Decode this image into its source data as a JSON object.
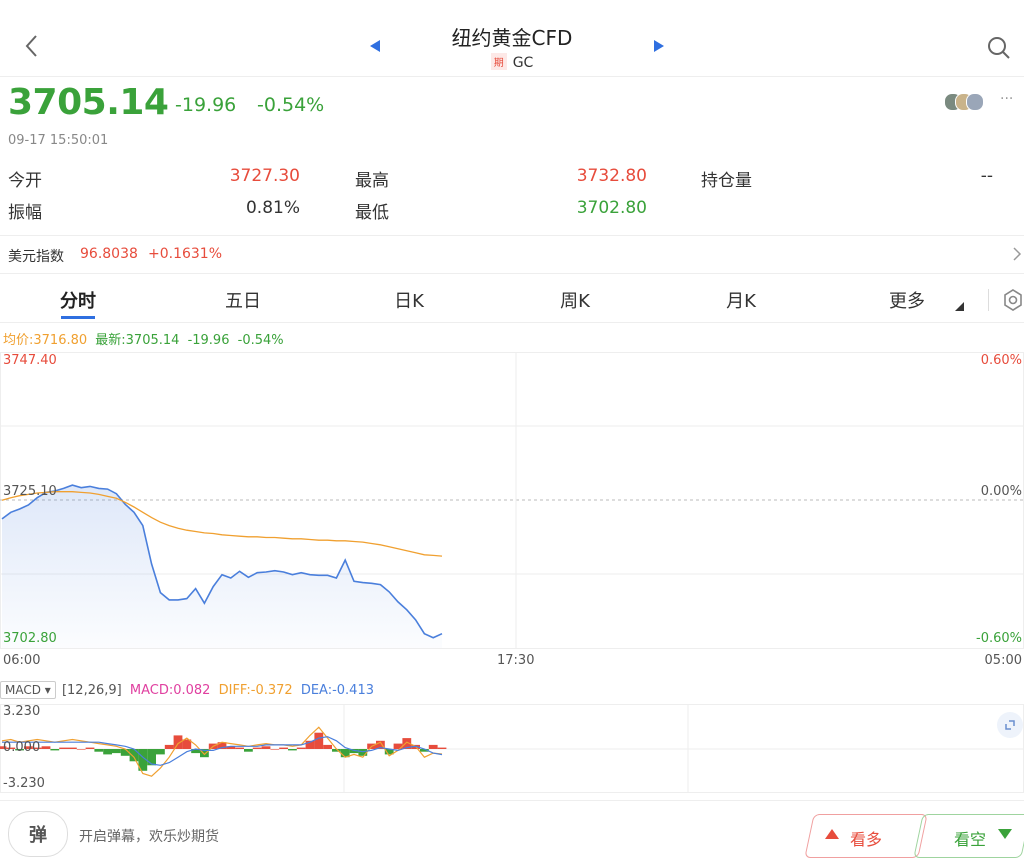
{
  "header": {
    "title": "纽约黄金CFD",
    "badge": "期",
    "code": "GC"
  },
  "quote": {
    "price": "3705.14",
    "change": "-19.96",
    "change_pct": "-0.54%",
    "time": "09-17 15:50:01",
    "open_label": "今开",
    "open": "3727.30",
    "high_label": "最高",
    "high": "3732.80",
    "oi_label": "持仓量",
    "oi": "--",
    "amplitude_label": "振幅",
    "amplitude": "0.81%",
    "low_label": "最低",
    "low": "3702.80"
  },
  "index": {
    "label": "美元指数",
    "value": "96.8038",
    "change": "+0.1631%"
  },
  "tabs": [
    "分时",
    "五日",
    "日K",
    "周K",
    "月K",
    "更多"
  ],
  "legend": {
    "avg": "均价:3716.80",
    "latest": "最新:3705.14",
    "chg": "-19.96",
    "pct": "-0.54%"
  },
  "chart_data": {
    "type": "line",
    "y_top": "3747.40",
    "y_mid": "3725.10",
    "y_bottom": "3702.80",
    "pct_top": "0.60%",
    "pct_mid": "0.00%",
    "pct_bottom": "-0.60%",
    "x_labels": [
      "06:00",
      "17:30",
      "05:00"
    ],
    "ylim": [
      3702.8,
      3747.4
    ],
    "price_series": [
      3722.4,
      3723.4,
      3723.9,
      3724.5,
      3725.6,
      3726.4,
      3726.6,
      3727.0,
      3727.5,
      3727.1,
      3727.3,
      3727.0,
      3726.9,
      3726.2,
      3724.6,
      3723.4,
      3721.4,
      3715.6,
      3711.3,
      3710.2,
      3710.2,
      3710.4,
      3711.9,
      3709.7,
      3712.2,
      3714.0,
      3713.5,
      3714.5,
      3713.6,
      3714.3,
      3714.4,
      3714.6,
      3714.4,
      3714.0,
      3714.3,
      3714.0,
      3713.9,
      3713.9,
      3713.5,
      3716.2,
      3713.0,
      3712.8,
      3712.7,
      3712.5,
      3711.4,
      3709.9,
      3708.7,
      3707.2,
      3705.1,
      3704.5,
      3705.1
    ],
    "avg_series": [
      3725.2,
      3725.6,
      3725.9,
      3726.1,
      3726.3,
      3726.4,
      3726.5,
      3726.5,
      3726.5,
      3726.4,
      3726.3,
      3726.1,
      3725.8,
      3725.5,
      3724.9,
      3724.2,
      3723.4,
      3722.6,
      3721.9,
      3721.4,
      3721.0,
      3720.7,
      3720.5,
      3720.3,
      3720.2,
      3720.0,
      3719.9,
      3719.8,
      3719.7,
      3719.7,
      3719.6,
      3719.6,
      3719.5,
      3719.4,
      3719.4,
      3719.3,
      3719.2,
      3719.2,
      3719.1,
      3719.1,
      3719.0,
      3718.9,
      3718.7,
      3718.5,
      3718.2,
      3717.9,
      3717.6,
      3717.3,
      3717.0,
      3716.9,
      3716.8
    ],
    "macd": {
      "legend_button": "MACD",
      "params": "[12,26,9]",
      "macd": "MACD:0.082",
      "diff": "DIFF:-0.372",
      "dea": "DEA:-0.413",
      "y_top": "3.230",
      "y_mid": "0.000",
      "y_bottom": "-3.230",
      "ylim": [
        -3.23,
        3.23
      ],
      "histogram": [
        0.2,
        0.1,
        -0.1,
        0.2,
        0.1,
        0.2,
        -0.1,
        0.1,
        0.1,
        0.0,
        0.1,
        -0.2,
        -0.4,
        -0.3,
        -0.5,
        -0.9,
        -1.6,
        -1.2,
        -0.4,
        0.3,
        1.0,
        0.7,
        -0.3,
        -0.6,
        0.4,
        0.5,
        0.2,
        0.1,
        -0.2,
        0.1,
        0.2,
        0.0,
        0.1,
        -0.1,
        0.1,
        0.6,
        1.2,
        0.3,
        -0.2,
        -0.6,
        -0.3,
        -0.5,
        0.4,
        0.6,
        -0.4,
        0.4,
        0.8,
        0.3,
        -0.2,
        0.3,
        0.1
      ],
      "diff_series": [
        0.6,
        0.7,
        0.5,
        0.6,
        0.7,
        0.6,
        0.5,
        0.6,
        0.7,
        0.6,
        0.5,
        0.4,
        0.3,
        0.2,
        0.0,
        -0.6,
        -1.8,
        -2.0,
        -1.4,
        -0.6,
        0.4,
        0.8,
        0.3,
        -0.4,
        0.2,
        0.5,
        0.4,
        0.3,
        0.2,
        0.3,
        0.4,
        0.3,
        0.3,
        0.2,
        0.3,
        1.0,
        1.6,
        0.8,
        0.0,
        -0.6,
        -0.4,
        -0.6,
        0.2,
        0.5,
        -0.5,
        -0.1,
        0.5,
        0.2,
        -0.6,
        -0.3,
        -0.37
      ],
      "dea_series": [
        0.5,
        0.5,
        0.5,
        0.5,
        0.5,
        0.5,
        0.5,
        0.5,
        0.5,
        0.5,
        0.5,
        0.5,
        0.4,
        0.3,
        0.2,
        0.0,
        -0.6,
        -1.1,
        -1.2,
        -1.0,
        -0.6,
        -0.2,
        0.0,
        -0.1,
        -0.1,
        0.1,
        0.2,
        0.2,
        0.2,
        0.2,
        0.3,
        0.3,
        0.3,
        0.3,
        0.3,
        0.5,
        0.8,
        0.9,
        0.6,
        0.1,
        -0.1,
        -0.2,
        -0.1,
        0.1,
        0.0,
        -0.1,
        0.1,
        0.2,
        0.0,
        -0.3,
        -0.41
      ]
    }
  },
  "bottom": {
    "danmaku_icon": "弹",
    "danmaku_text": "开启弹幕，欢乐炒期货",
    "long": "看多",
    "short": "看空"
  },
  "colors": {
    "price_line": "#4a7fdc",
    "avg_line": "#f0a030",
    "up": "#e74c3c",
    "down": "#3aa23a"
  }
}
